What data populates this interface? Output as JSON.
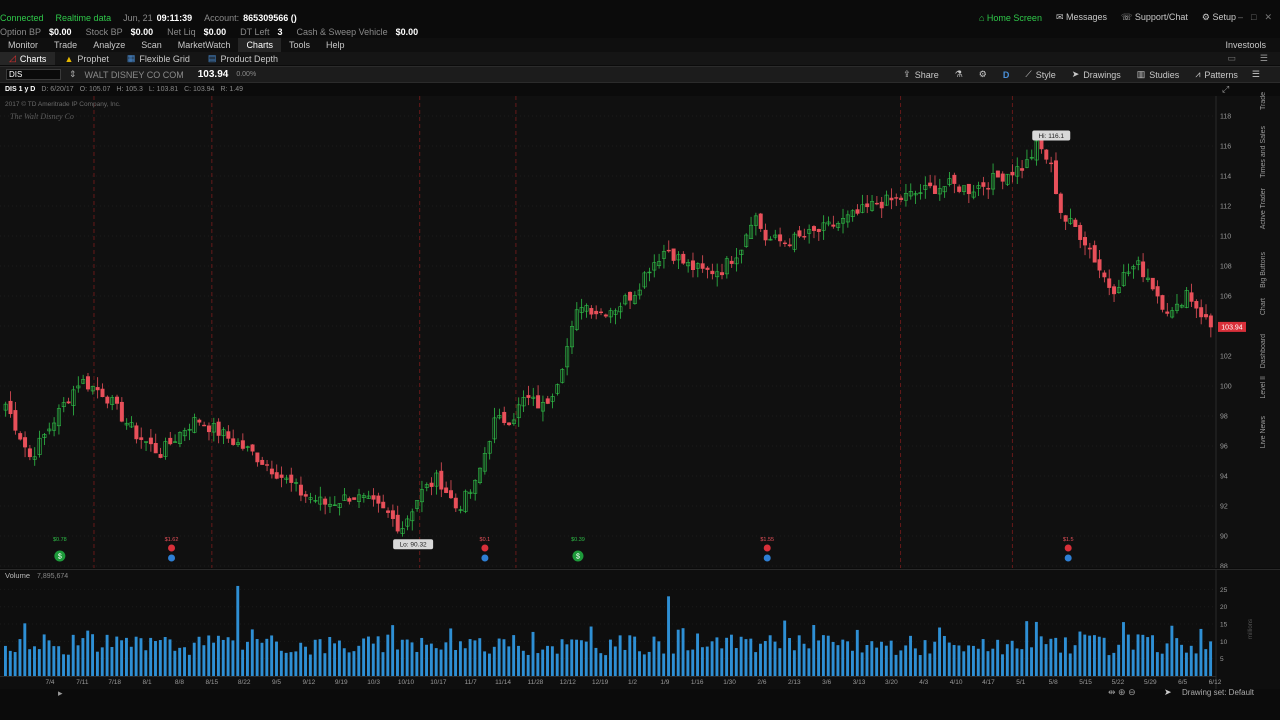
{
  "status": {
    "connected": "Connected",
    "realtime": "Realtime data",
    "date": "Jun, 21",
    "time": "09:11:39",
    "account_label": "Account:",
    "account_value": "865309566 ()"
  },
  "balances": [
    {
      "label": "Option BP",
      "value": "$0.00"
    },
    {
      "label": "Stock BP",
      "value": "$0.00"
    },
    {
      "label": "Net Liq",
      "value": "$0.00"
    },
    {
      "label": "DT Left",
      "value": "3"
    },
    {
      "label": "Cash & Sweep Vehicle",
      "value": "$0.00"
    }
  ],
  "top_links": {
    "home": "Home Screen",
    "messages": "Messages",
    "support": "Support/Chat",
    "setup": "Setup"
  },
  "menu": [
    "Monitor",
    "Trade",
    "Analyze",
    "Scan",
    "MarketWatch",
    "Charts",
    "Tools",
    "Help"
  ],
  "menu_active": "Charts",
  "menu_right": "Investools",
  "subtabs": [
    "Charts",
    "Prophet",
    "Flexible Grid",
    "Product Depth"
  ],
  "toolbar": {
    "symbol": "DIS",
    "company": "WALT DISNEY CO COM",
    "price": "103.94",
    "change": "0.00%",
    "share": "Share",
    "d_label": "D",
    "style": "Style",
    "drawings": "Drawings",
    "studies": "Studies",
    "patterns": "Patterns"
  },
  "infobar": {
    "title": "DIS 1 y D",
    "d": "D: 6/20/17",
    "o": "O: 105.07",
    "h": "H: 105.3",
    "l": "L: 103.81",
    "c": "C: 103.94",
    "r": "R: 1.49",
    "copyright": "2017 © TD Ameritrade IP Company, Inc.",
    "watermark": "The Walt Disney Co"
  },
  "colors": {
    "up": "#2fbf48",
    "down": "#e8505a",
    "volume": "#2e8fd4",
    "grid": "#1f1f1f",
    "accent_red": "#e03030"
  },
  "chart_data": {
    "type": "candlestick",
    "price_ticks": [
      88,
      90,
      92,
      94,
      96,
      98,
      100,
      102,
      104,
      106,
      108,
      110,
      112,
      114,
      116,
      118
    ],
    "ylim": [
      88,
      119
    ],
    "high_label": "Hi: 116.1",
    "low_label": "Lo: 90.32",
    "last_price_label": "103.94",
    "x_ticks": [
      "7/4",
      "7/11",
      "7/18",
      "8/1",
      "8/8",
      "8/15",
      "8/22",
      "9/5",
      "9/12",
      "9/19",
      "10/3",
      "10/10",
      "10/17",
      "11/7",
      "11/14",
      "11/28",
      "12/12",
      "12/19",
      "1/2",
      "1/9",
      "1/16",
      "1/30",
      "2/6",
      "2/13",
      "3/6",
      "3/13",
      "3/20",
      "4/3",
      "4/10",
      "4/17",
      "5/1",
      "5/8",
      "5/15",
      "5/22",
      "5/29",
      "6/5",
      "6/12"
    ],
    "price_path": [
      [
        0,
        98.8
      ],
      [
        8,
        95.2
      ],
      [
        18,
        98.5
      ],
      [
        24,
        100.4
      ],
      [
        32,
        99.5
      ],
      [
        42,
        96.8
      ],
      [
        50,
        95.5
      ],
      [
        58,
        97.2
      ],
      [
        62,
        97.8
      ],
      [
        70,
        96.8
      ],
      [
        80,
        95.5
      ],
      [
        88,
        94.2
      ],
      [
        96,
        92.8
      ],
      [
        104,
        92.1
      ],
      [
        112,
        92.7
      ],
      [
        118,
        92.2
      ],
      [
        124,
        91.4
      ],
      [
        128,
        90.5
      ],
      [
        134,
        92.8
      ],
      [
        140,
        93.9
      ],
      [
        146,
        91.8
      ],
      [
        152,
        93.4
      ],
      [
        158,
        97.6
      ],
      [
        164,
        97.9
      ],
      [
        168,
        99.2
      ],
      [
        174,
        98.6
      ],
      [
        178,
        100.1
      ],
      [
        182,
        102.8
      ],
      [
        186,
        105.6
      ],
      [
        192,
        104.9
      ],
      [
        198,
        105.3
      ],
      [
        204,
        106.4
      ],
      [
        208,
        107.9
      ],
      [
        214,
        109.2
      ],
      [
        220,
        108.1
      ],
      [
        226,
        107.6
      ],
      [
        232,
        107.8
      ],
      [
        238,
        109.3
      ],
      [
        242,
        111.6
      ],
      [
        246,
        109.8
      ],
      [
        252,
        109.6
      ],
      [
        258,
        109.9
      ],
      [
        264,
        110.4
      ],
      [
        270,
        110.9
      ],
      [
        276,
        111.5
      ],
      [
        282,
        112.2
      ],
      [
        288,
        112.4
      ],
      [
        294,
        112.8
      ],
      [
        300,
        113.2
      ],
      [
        306,
        113.4
      ],
      [
        312,
        113.1
      ],
      [
        318,
        113.6
      ],
      [
        324,
        114.2
      ],
      [
        330,
        114.7
      ],
      [
        334,
        116.1
      ],
      [
        338,
        114.8
      ],
      [
        342,
        111.2
      ],
      [
        346,
        110.6
      ],
      [
        350,
        109.5
      ],
      [
        354,
        107.8
      ],
      [
        358,
        106.4
      ],
      [
        362,
        107.4
      ],
      [
        366,
        108.1
      ],
      [
        370,
        107.2
      ],
      [
        374,
        105.6
      ],
      [
        378,
        104.7
      ],
      [
        382,
        106.4
      ],
      [
        386,
        105.1
      ],
      [
        390,
        103.94
      ]
    ],
    "bar_count": 250,
    "dividends": [
      {
        "label": "$0.78",
        "bar": 18,
        "color": "green"
      },
      {
        "label": "$1.62",
        "bar": 54,
        "color": "red"
      },
      {
        "label": "$0.1",
        "bar": 155,
        "color": "red"
      },
      {
        "label": "$0.39",
        "bar": 185,
        "color": "green"
      },
      {
        "label": "$1.55",
        "bar": 246,
        "color": "red"
      },
      {
        "label": "$1.5",
        "bar": 343,
        "color": "red"
      }
    ],
    "vertical_markers": [
      29,
      67,
      134,
      165,
      289,
      325
    ],
    "volume": {
      "label": "Volume",
      "last": "7,895,674",
      "ticks": [
        5,
        10,
        15,
        20,
        25
      ],
      "unit": "millions",
      "ylim": [
        0,
        28
      ]
    }
  },
  "bottom": {
    "drawing_set": "Drawing set: Default"
  },
  "sidebar_tabs": [
    "Trade",
    "Times and Sales",
    "Active Trader",
    "Big Buttons",
    "Chart",
    "Dashboard",
    "Level II",
    "Live News"
  ]
}
